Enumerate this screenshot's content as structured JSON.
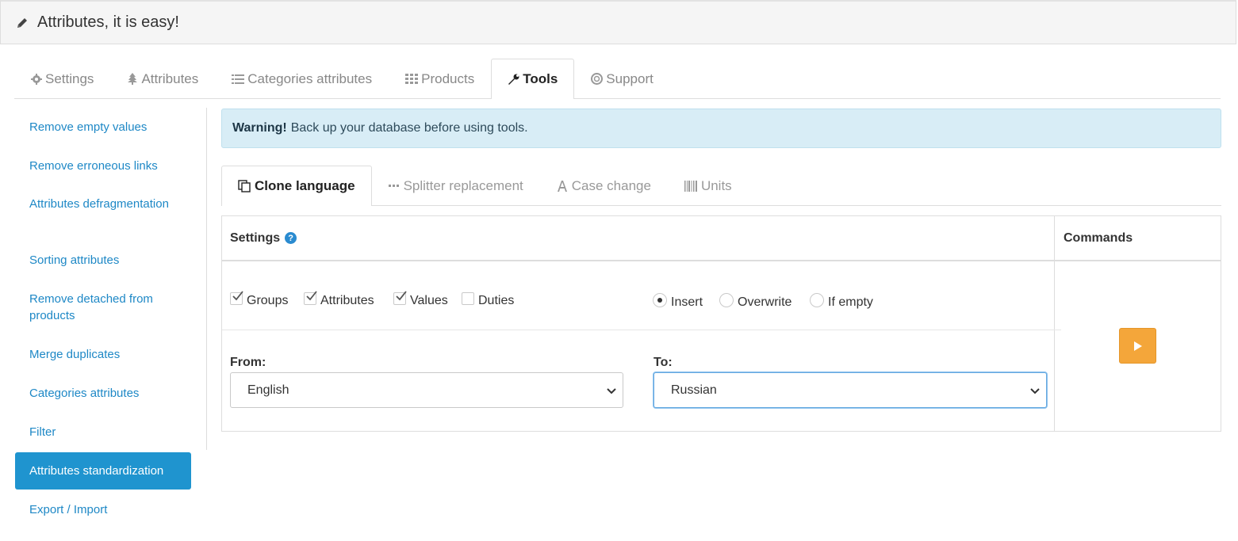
{
  "header": {
    "title": "Attributes, it is easy!",
    "icon": "pencil-icon"
  },
  "main_tabs": [
    {
      "label": "Settings",
      "icon": "gear-icon"
    },
    {
      "label": "Attributes",
      "icon": "tree-icon"
    },
    {
      "label": "Categories attributes",
      "icon": "list-icon"
    },
    {
      "label": "Products",
      "icon": "grid-icon"
    },
    {
      "label": "Tools",
      "icon": "wrench-icon",
      "active": true
    },
    {
      "label": "Support",
      "icon": "lifebuoy-icon"
    }
  ],
  "sidebar": {
    "items": [
      {
        "label": "Remove empty values"
      },
      {
        "label": "Remove erroneous links"
      },
      {
        "label": "Attributes defragmentation"
      },
      {
        "label": "Sorting attributes"
      },
      {
        "label": "Remove detached from products"
      },
      {
        "label": "Merge duplicates"
      },
      {
        "label": "Categories attributes"
      },
      {
        "label": "Filter"
      },
      {
        "label": "Attributes standardization",
        "active": true
      },
      {
        "label": "Export / Import"
      }
    ]
  },
  "alert": {
    "strong": "Warning!",
    "text": "Back up your database before using tools."
  },
  "sub_tabs": [
    {
      "label": "Clone language",
      "icon": "copy-icon",
      "active": true
    },
    {
      "label": "Splitter replacement",
      "icon": "ellipsis-icon"
    },
    {
      "label": "Case change",
      "icon": "font-icon"
    },
    {
      "label": "Units",
      "icon": "barcode-icon"
    }
  ],
  "table": {
    "settings_header": "Settings",
    "commands_header": "Commands",
    "checkboxes": [
      {
        "label": "Groups",
        "checked": true
      },
      {
        "label": "Attributes",
        "checked": true
      },
      {
        "label": "Values",
        "checked": true
      },
      {
        "label": "Duties",
        "checked": false
      }
    ],
    "radios": [
      {
        "label": "Insert",
        "selected": true
      },
      {
        "label": "Overwrite",
        "selected": false
      },
      {
        "label": "If empty",
        "selected": false
      }
    ],
    "from": {
      "label": "From:",
      "value": "English"
    },
    "to": {
      "label": "To:",
      "value": "Russian"
    }
  },
  "colors": {
    "link": "#1e88c6",
    "active_sidebar": "#1f94cf",
    "alert_bg": "#d8edf6",
    "run_button": "#f4a63a"
  }
}
